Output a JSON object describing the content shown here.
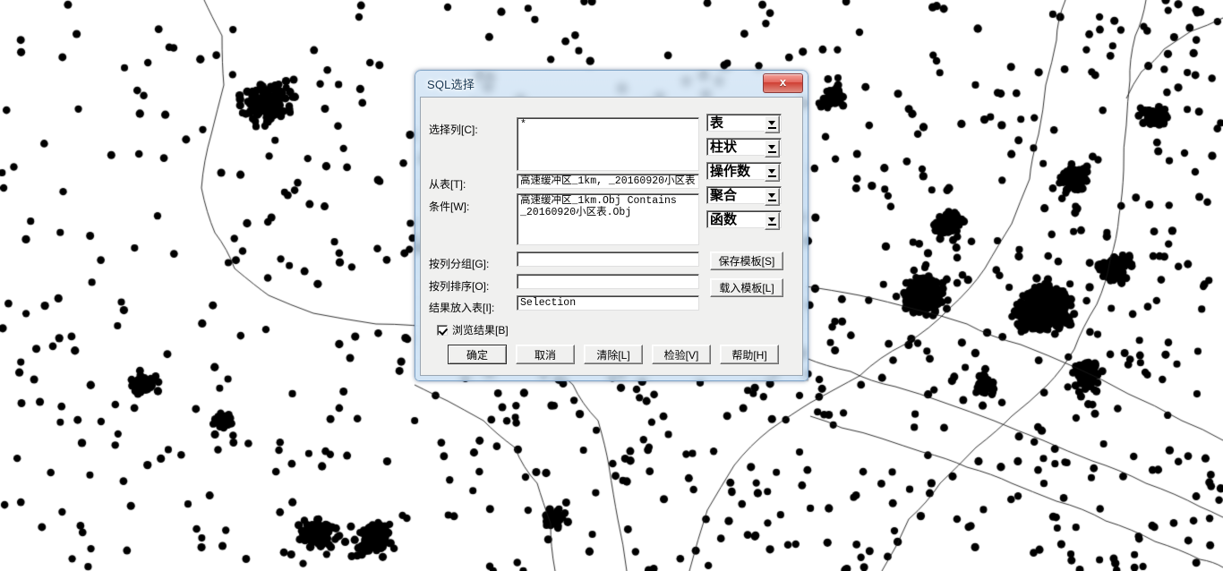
{
  "map": {
    "description": "point-distribution-map",
    "point_color": "#000000",
    "line_color": "#1a1a1a",
    "background": "#ffffff"
  },
  "dialog": {
    "title": "SQL选择",
    "close_label": "x",
    "fields": [
      {
        "label": "选择列[C]:",
        "value": "*"
      },
      {
        "label": "从表[T]:",
        "value": "高速缓冲区_1km, _20160920小区表"
      },
      {
        "label": "条件[W]:",
        "value": "高速缓冲区_1km.Obj Contains\n_20160920小区表.Obj"
      },
      {
        "label": "按列分组[G]:",
        "value": ""
      },
      {
        "label": "按列排序[O]:",
        "value": ""
      },
      {
        "label": "结果放入表[I]:",
        "value": "Selection"
      }
    ],
    "combos": [
      {
        "value": "表"
      },
      {
        "value": "柱状"
      },
      {
        "value": "操作数"
      },
      {
        "value": "聚合"
      },
      {
        "value": "函数"
      }
    ],
    "side_buttons": [
      {
        "label": "保存模板[S]"
      },
      {
        "label": "载入模板[L]"
      }
    ],
    "checkbox": {
      "label": "浏览结果[B]",
      "checked": true
    },
    "buttons": [
      {
        "label": "确定",
        "default": true
      },
      {
        "label": "取消",
        "default": false
      },
      {
        "label": "清除[L]",
        "default": false
      },
      {
        "label": "检验[V]",
        "default": false
      },
      {
        "label": "帮助[H]",
        "default": false
      }
    ]
  }
}
